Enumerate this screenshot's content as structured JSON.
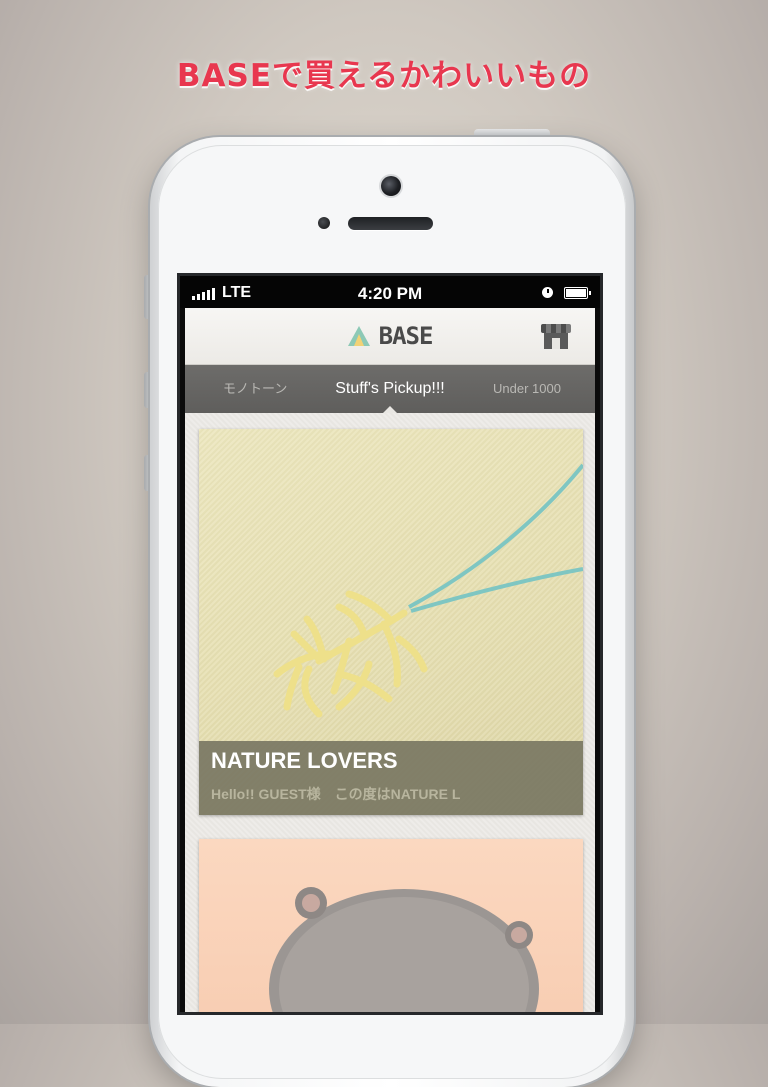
{
  "promo": {
    "headline": "BASEで買えるかわいいもの"
  },
  "status_bar": {
    "carrier": "LTE",
    "time": "4:20 PM"
  },
  "nav": {
    "logo_text": "BASE"
  },
  "tabs": {
    "left": "モノトーン",
    "active": "Stuff's Pickup!!!",
    "right": "Under 1000"
  },
  "feed": {
    "items": [
      {
        "title": "NATURE LOVERS",
        "description": "Hello!! GUEST様　この度はNATURE L"
      },
      {
        "title": "",
        "description": ""
      }
    ]
  },
  "tab_bar": {
    "star_icon": "★",
    "cart_icon": "🛒"
  },
  "colors": {
    "headline": "#e8374f",
    "caption_bg": "#7a7763",
    "tabs_bg": "#666563"
  }
}
